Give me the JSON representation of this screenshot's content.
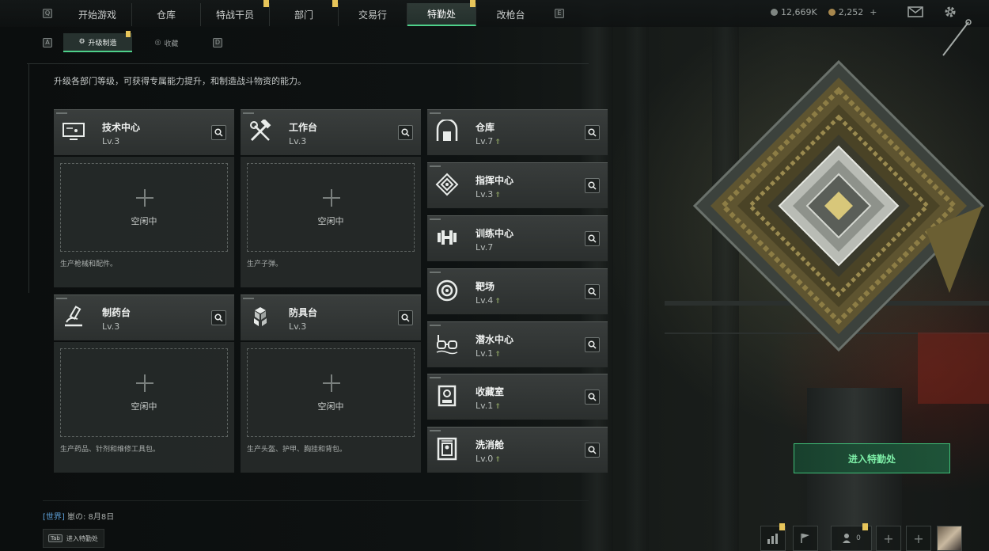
{
  "nav": {
    "left_key": "Q",
    "right_key": "E",
    "tabs": [
      {
        "label": "开始游戏"
      },
      {
        "label": "仓库"
      },
      {
        "label": "特战干员"
      },
      {
        "label": "部门"
      },
      {
        "label": "交易行"
      },
      {
        "label": "特勤处"
      },
      {
        "label": "改枪台"
      }
    ]
  },
  "resources": {
    "coins": "12,669K",
    "tickets": "2,252"
  },
  "subtabs": {
    "left_key": "A",
    "right_key": "D",
    "items": [
      {
        "label": "升级制造"
      },
      {
        "label": "收藏"
      }
    ]
  },
  "description": "升级各部门等级，可获得专属能力提升，和制造战斗物资的能力。",
  "production": [
    {
      "name": "技术中心",
      "level": "Lv.3",
      "status": "空闲中",
      "produces": "生产枪械和配件。"
    },
    {
      "name": "工作台",
      "level": "Lv.3",
      "status": "空闲中",
      "produces": "生产子弹。"
    },
    {
      "name": "制药台",
      "level": "Lv.3",
      "status": "空闲中",
      "produces": "生产药品、针剂和维修工具包。"
    },
    {
      "name": "防具台",
      "level": "Lv.3",
      "status": "空闲中",
      "produces": "生产头盔、护甲、胸挂和背包。"
    }
  ],
  "facilities": [
    {
      "name": "仓库",
      "level": "Lv.7",
      "upgradable": true
    },
    {
      "name": "指挥中心",
      "level": "Lv.3",
      "upgradable": true
    },
    {
      "name": "训练中心",
      "level": "Lv.7",
      "upgradable": false
    },
    {
      "name": "靶场",
      "level": "Lv.4",
      "upgradable": true
    },
    {
      "name": "潜水中心",
      "level": "Lv.1",
      "upgradable": true
    },
    {
      "name": "收藏室",
      "level": "Lv.1",
      "upgradable": true
    },
    {
      "name": "洗消舱",
      "level": "Lv.0",
      "upgradable": true
    }
  ],
  "enter_button": "进入特勤处",
  "chat": {
    "channel": "[世界]",
    "message": "崽の: 8月8日"
  },
  "tab_hint": {
    "key": "Tab",
    "label": "进入特勤处"
  },
  "bottom": {
    "friends_count": "0"
  },
  "colors": {
    "accent": "#4ed08a",
    "badge": "#e7c55a",
    "upgrade": "#9bb36a"
  }
}
